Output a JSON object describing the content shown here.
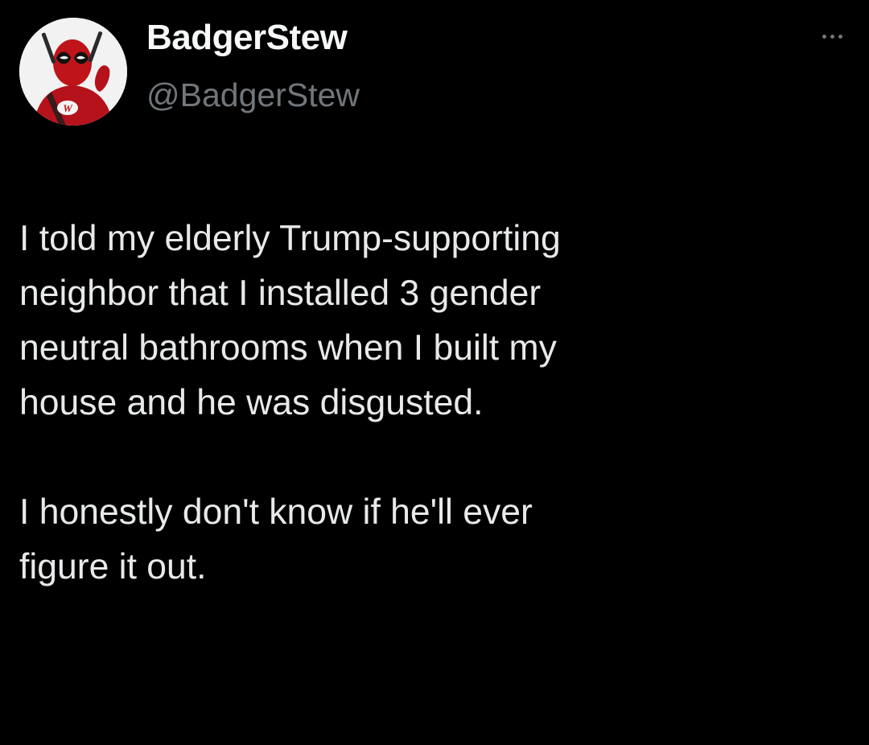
{
  "tweet": {
    "author": {
      "display_name": "BadgerStew",
      "handle": "@BadgerStew",
      "avatar_icon": "masked-hero-avatar",
      "avatar_colors": {
        "suit": "#c0141b",
        "mask_eye": "#111111",
        "background": "#f2f2f2"
      }
    },
    "more_icon": "more-horizontal-icon",
    "paragraphs": [
      "I told my elderly Trump-supporting\nneighbor that I installed 3 gender\nneutral bathrooms when I built my\nhouse and he was disgusted.",
      "I honestly don't know if he'll ever\nfigure it out."
    ]
  },
  "theme": {
    "background": "#000000",
    "text_primary": "#e7e9ea",
    "text_secondary": "#71767b"
  }
}
